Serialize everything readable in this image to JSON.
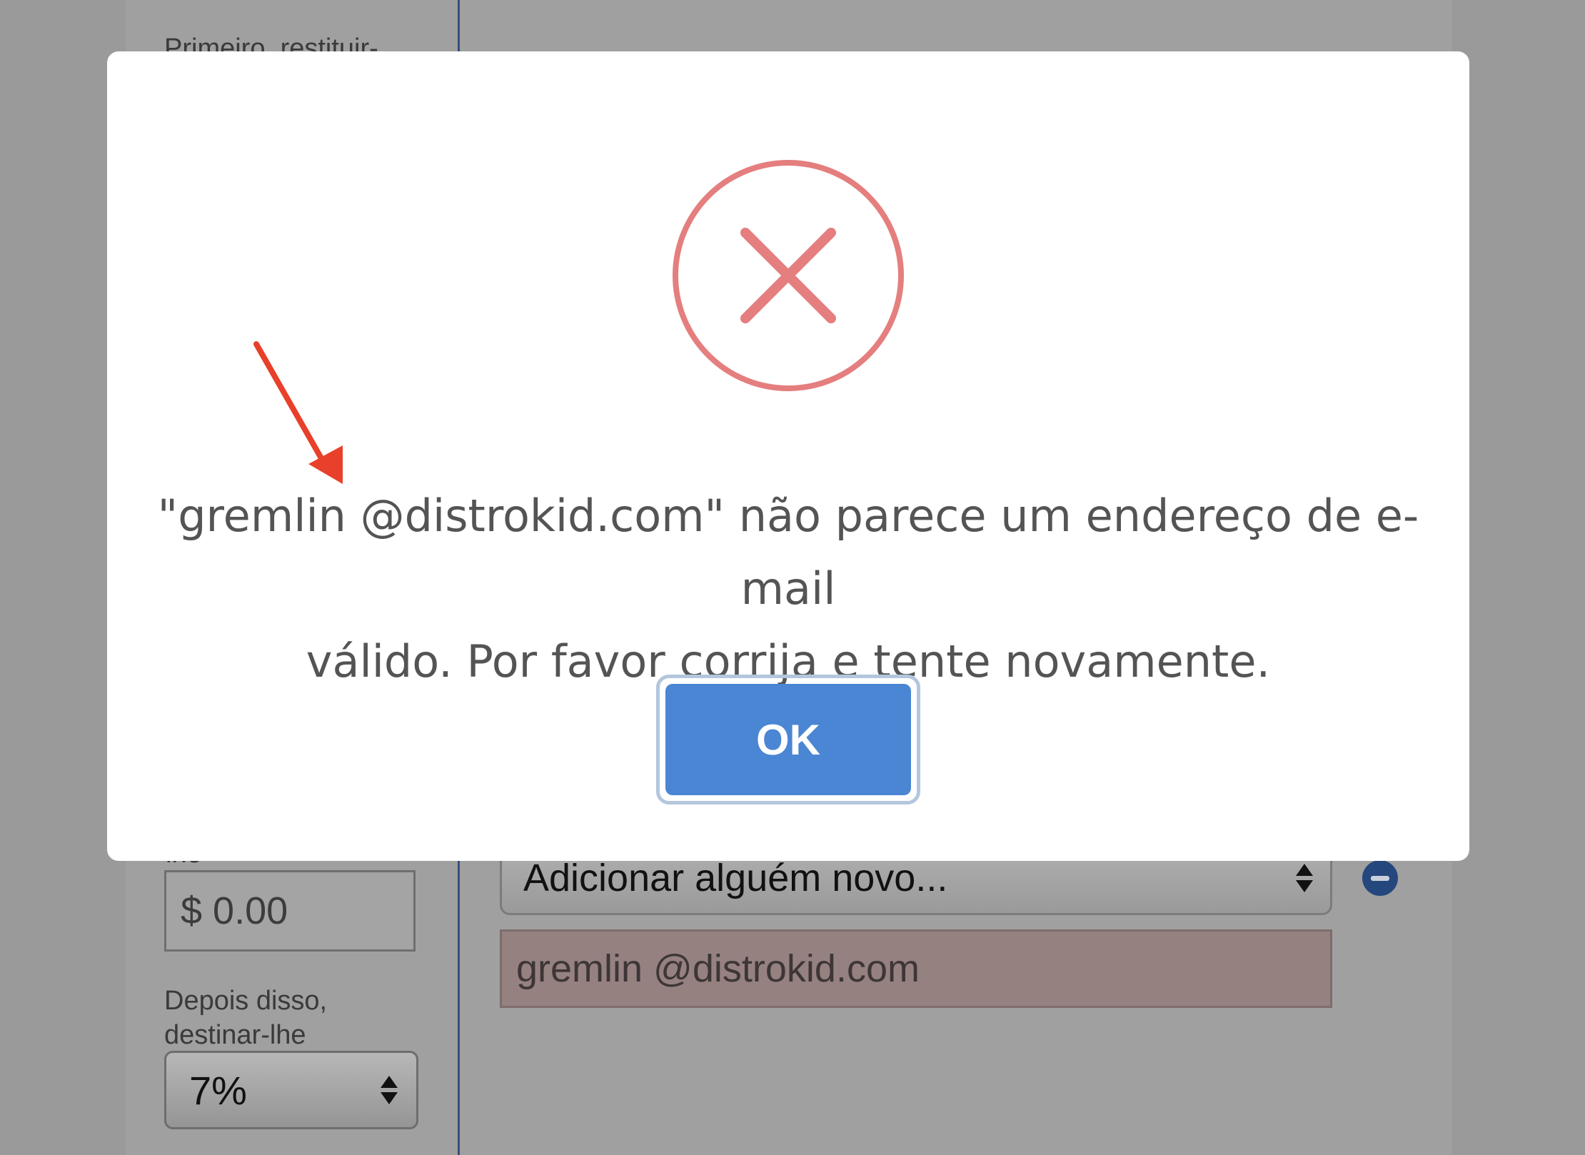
{
  "background": {
    "first_label_cut": "Primeiro, restituir-",
    "second_label_cut": "lhe",
    "amount_value": "$ 0.00",
    "after_label_line1": "Depois disso,",
    "after_label_line2": "destinar-lhe",
    "percent_value": "7%",
    "person_select_value": "Adicionar alguém novo...",
    "email_value": "gremlin @distrokid.com"
  },
  "dialog": {
    "icon": "error-x-icon",
    "message_line1": "\"gremlin @distrokid.com\" não parece um endereço de e-mail",
    "message_line2": "válido. Por favor corrija e tente novamente.",
    "ok_label": "OK"
  },
  "colors": {
    "error_icon": "#e57e7e",
    "ok_button": "#4a86d4",
    "annotation_arrow": "#e8402a",
    "invalid_field": "#968181"
  }
}
